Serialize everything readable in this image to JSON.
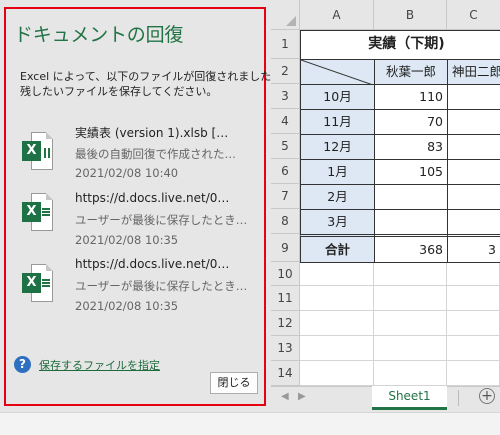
{
  "recovery_pane": {
    "title": "ドキュメントの回復",
    "message_line1": "Excel によって、以下のファイルが回復されました。",
    "message_line2": "残したいファイルを保存してください。",
    "files": [
      {
        "name": "実績表 (version 1).xlsb  […",
        "description": "最後の自動回復で作成された…",
        "date": "2021/02/08 10:40",
        "icon": "excel-autorecover-file-icon"
      },
      {
        "name": "https://d.docs.live.net/0…",
        "description": "ユーザーが最後に保存したとき…",
        "date": "2021/02/08 10:35",
        "icon": "excel-file-icon"
      },
      {
        "name": "https://d.docs.live.net/0…",
        "description": "ユーザーが最後に保存したとき…",
        "date": "2021/02/08 10:35",
        "icon": "excel-file-icon"
      }
    ],
    "help_link": "保存するファイルを指定",
    "close_button": "閉じる",
    "highlight_color": "#e60012",
    "accent_color": "#217346"
  },
  "sheet": {
    "columns": [
      "A",
      "B",
      "C"
    ],
    "rows": [
      "1",
      "2",
      "3",
      "4",
      "5",
      "6",
      "7",
      "8",
      "9",
      "10",
      "11",
      "12",
      "13",
      "14"
    ],
    "title": "実績（下期)",
    "headers": {
      "b": "秋葉一郎",
      "c": "神田二郎"
    },
    "data_rows": [
      {
        "month": "10月",
        "b": "110",
        "c": ""
      },
      {
        "month": "11月",
        "b": "70",
        "c": ""
      },
      {
        "month": "12月",
        "b": "83",
        "c": ""
      },
      {
        "month": "1月",
        "b": "105",
        "c": ""
      },
      {
        "month": "2月",
        "b": "",
        "c": ""
      },
      {
        "month": "3月",
        "b": "",
        "c": ""
      }
    ],
    "total_label": "合計",
    "total_b": "368",
    "total_c": "3",
    "tab": "Sheet1",
    "header_fill_color": "#dde8f4"
  }
}
